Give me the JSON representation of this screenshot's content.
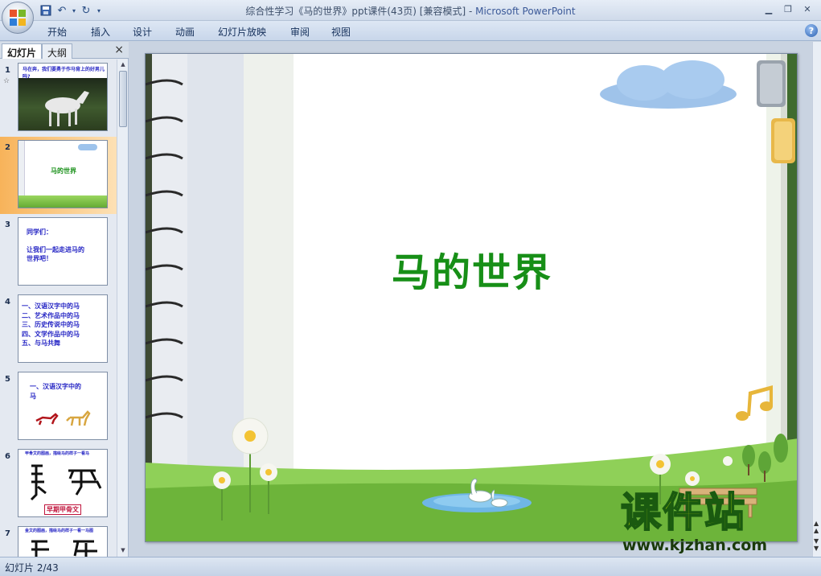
{
  "window": {
    "title": "综合性学习《马的世界》ppt课件(43页) [兼容模式] - ",
    "app_name": "Microsoft PowerPoint"
  },
  "ribbon": {
    "tabs": [
      "开始",
      "插入",
      "设计",
      "动画",
      "幻灯片放映",
      "审阅",
      "视图"
    ]
  },
  "panel": {
    "tab_slides": "幻灯片",
    "tab_outline": "大纲",
    "close": "×"
  },
  "thumbnails": [
    {
      "num": "1",
      "anim": "☆",
      "lines": [
        "马在奔，我们要勇于作马背上的好男儿吗?"
      ]
    },
    {
      "num": "2",
      "lines": [
        "马的世界"
      ]
    },
    {
      "num": "3",
      "lines": [
        "同学们：",
        "",
        "让我们一起走进马的",
        "世界吧！"
      ]
    },
    {
      "num": "4",
      "lines": [
        "一、汉语汉字中的马",
        "二、艺术作品中的马",
        "三、历史传说中的马",
        "四、文学作品中的马",
        "五、与马共舞"
      ]
    },
    {
      "num": "5",
      "lines": [
        "一、汉语汉字中的",
        "马"
      ]
    },
    {
      "num": "6",
      "lines": [
        "甲骨文的图画，描绘马的样子一看马",
        "早期甲骨文"
      ]
    },
    {
      "num": "7",
      "lines": [
        "金文的图画，描绘马的样子一看一马图"
      ]
    }
  ],
  "slide": {
    "title": "马的世界"
  },
  "watermark": {
    "main": "课件站",
    "url": "www.kjzhan.com"
  },
  "status": {
    "text": "幻灯片 2/43"
  },
  "colors": {
    "title_green": "#178f17",
    "selected_thumb": "#f7b35a",
    "grass": "#7cc04a"
  }
}
